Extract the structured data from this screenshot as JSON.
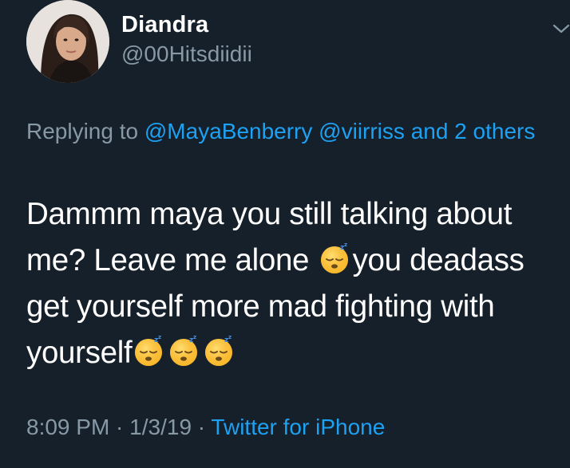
{
  "author": {
    "display_name": "Diandra",
    "handle": "@00Hitsdiidii",
    "avatar_icon": "profile-photo"
  },
  "reply": {
    "prefix": "Replying to ",
    "mentions": [
      "@MayaBenberry",
      "@viirriss"
    ],
    "others": "and 2 others"
  },
  "tweet": {
    "segment_1": "Dammm maya you still talking about me? Leave me alone ",
    "segment_2": "you deadass get yourself more mad fighting with yourself",
    "emoji_icon": "sleeping-face-emoji"
  },
  "meta": {
    "time": "8:09 PM",
    "separator_1": " · ",
    "date": "1/3/19",
    "separator_2": " · ",
    "source": "Twitter for iPhone"
  },
  "colors": {
    "background": "#15202b",
    "text": "#ffffff",
    "secondary": "#8899a6",
    "link": "#1da1f2"
  }
}
